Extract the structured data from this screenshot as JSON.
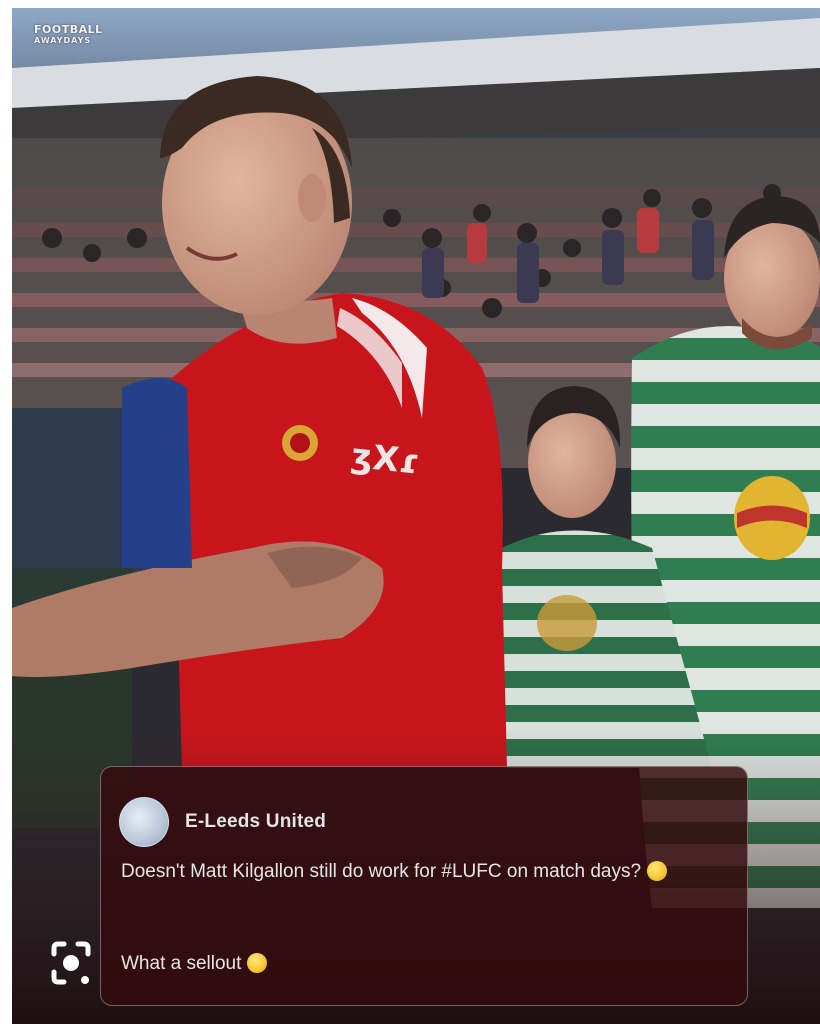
{
  "watermark": {
    "line1": "FOOTBALL",
    "line2": "AWAYDAYS"
  },
  "comment": {
    "username": "E-Leeds United",
    "text": "Doesn't Matt Kilgallon still do work for #LUFC on match days?",
    "reply": "What a sellout"
  },
  "icons": {
    "lens": "visual-search-icon",
    "avatar": "avatar",
    "emoji1": "thinking-face-emoji",
    "emoji2": "grinning-face-emoji"
  },
  "colors": {
    "red_kit": "#c8151b",
    "hoops_green": "#2f7d50",
    "card_bg": "#340a0e"
  }
}
